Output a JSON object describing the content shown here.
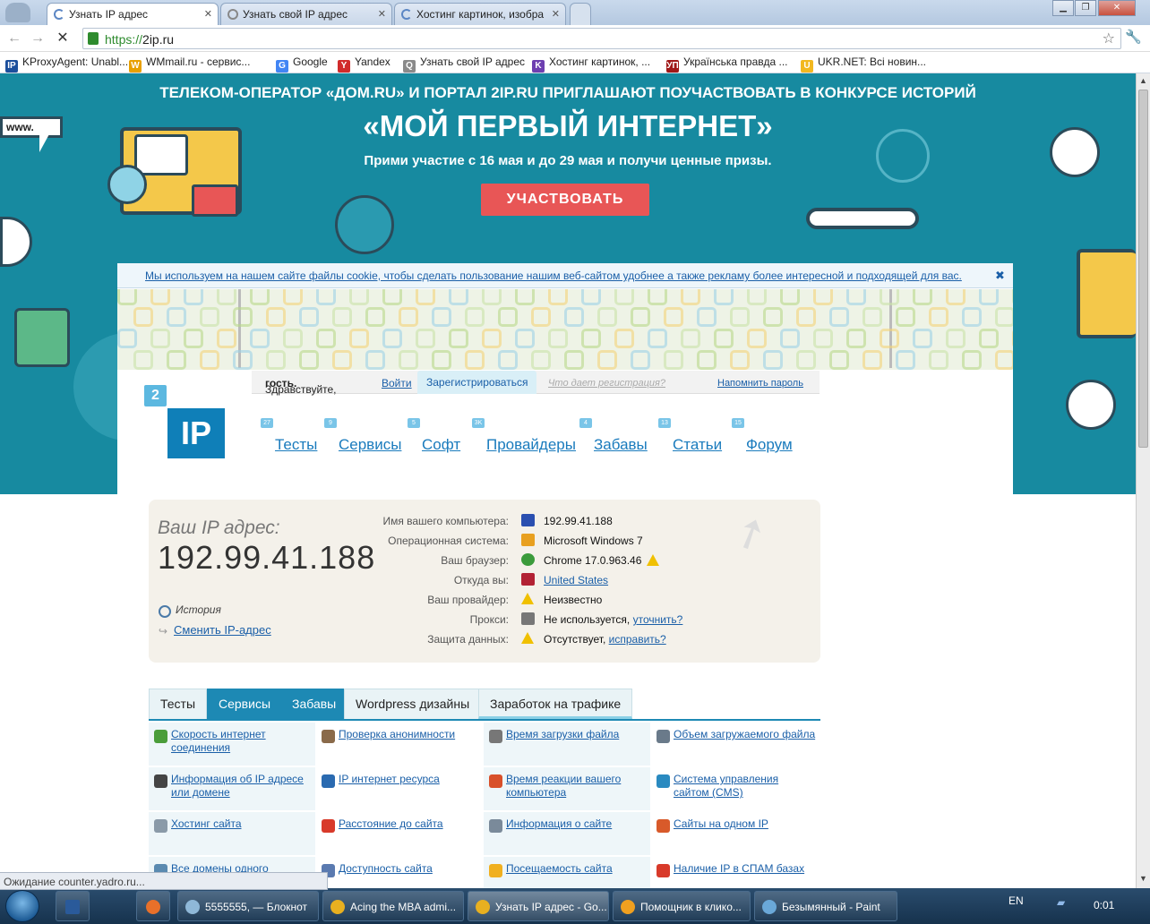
{
  "browser": {
    "tabs": [
      {
        "label": "Узнать IP адрес",
        "active": true
      },
      {
        "label": "Узнать свой IP адрес",
        "active": false
      },
      {
        "label": "Хостинг картинок, изобра",
        "active": false
      }
    ],
    "url_protocol": "https://",
    "url_host": "2ip.ru",
    "bookmarks": [
      {
        "label": "KProxyAgent: Unabl...",
        "icon": "kproxy-icon",
        "color": "#1c4f9c",
        "glyph": "IP"
      },
      {
        "label": "WMmail.ru - сервис...",
        "icon": "wmmail-icon",
        "color": "#e8a000",
        "glyph": "W"
      },
      {
        "label": "Google",
        "icon": "google-icon",
        "color": "#4285f4",
        "glyph": "G"
      },
      {
        "label": "Yandex",
        "icon": "yandex-icon",
        "color": "#d12b2b",
        "glyph": "Y"
      },
      {
        "label": "Узнать свой IP адрес",
        "icon": "search-icon",
        "color": "#8a8a8a",
        "glyph": "Q"
      },
      {
        "label": "Хостинг картинок, ...",
        "icon": "hosting-icon",
        "color": "#6d3fb0",
        "glyph": "K"
      },
      {
        "label": "Українська правда ...",
        "icon": "pravda-icon",
        "color": "#a01818",
        "glyph": "УП"
      },
      {
        "label": "UKR.NET: Всі новин...",
        "icon": "ukrnet-icon",
        "color": "#f2b820",
        "glyph": "U"
      }
    ],
    "status": "Ожидание counter.yadro.ru..."
  },
  "banner": {
    "line1": "ТЕЛЕКОМ-ОПЕРАТОР «ДОМ.RU» И ПОРТАЛ 2IP.RU ПРИГЛАШАЮТ ПОУЧАСТВОВАТЬ В КОНКУРСЕ ИСТОРИЙ",
    "title": "«МОЙ ПЕРВЫЙ ИНТЕРНЕТ»",
    "subtitle": "Прими участие с 16 мая и до 29 мая и получи ценные призы.",
    "cta": "УЧАСТВОВАТЬ",
    "www": "www."
  },
  "cookie": {
    "text": "Мы используем на нашем сайте файлы cookie, чтобы сделать пользование нашим веб-сайтом удобнее а также рекламу более интересной и подходящей для вас.",
    "close": "✖"
  },
  "userbar": {
    "greeting": "Здравствуйте, ",
    "guest": "гость.",
    "login": "Войти",
    "register": "Зарегистрироваться",
    "why": "Что дает регистрация?",
    "remind": "Напомнить пароль"
  },
  "logo": {
    "badge": "2",
    "text": "IP"
  },
  "nav": [
    {
      "label": "Тесты",
      "badge": "27"
    },
    {
      "label": "Сервисы",
      "badge": "9"
    },
    {
      "label": "Софт",
      "badge": "5"
    },
    {
      "label": "Провайдеры",
      "badge": "3K"
    },
    {
      "label": "Забавы",
      "badge": "4"
    },
    {
      "label": "Статьи",
      "badge": "13"
    },
    {
      "label": "Форум",
      "badge": "15"
    }
  ],
  "ipinfo": {
    "your_ip_label": "Ваш IP адрес:",
    "ip": "192.99.41.188",
    "history": "История",
    "change_ip": "Сменить IP-адрес",
    "rows": [
      {
        "label": "Имя вашего компьютера:",
        "value": "192.99.41.188",
        "link": "",
        "warn": false,
        "icon": "computer-icon",
        "color": "#2a4fb0"
      },
      {
        "label": "Операционная система:",
        "value": "Microsoft Windows 7",
        "link": "",
        "warn": false,
        "icon": "windows-icon",
        "color": "#e8a020"
      },
      {
        "label": "Ваш браузер:",
        "value": "Chrome 17.0.963.46",
        "link": "",
        "warn": true,
        "icon": "chrome-icon",
        "color": "#3b9b3b"
      },
      {
        "label": "Откуда вы:",
        "value": "",
        "link": "United States",
        "warn": false,
        "icon": "us-flag-icon",
        "color": "#b22234"
      },
      {
        "label": "Ваш провайдер:",
        "value": "Неизвестно",
        "link": "",
        "warn": false,
        "icon": "warning-icon",
        "color": "#f0c000"
      },
      {
        "label": "Прокси:",
        "value": "Не используется, ",
        "link": "уточнить?",
        "warn": false,
        "icon": "glasses-icon",
        "color": "#777777"
      },
      {
        "label": "Защита данных:",
        "value": "Отсутствует, ",
        "link": "исправить?",
        "warn": false,
        "icon": "warning-icon",
        "color": "#f0c000"
      }
    ]
  },
  "page_tabs": [
    {
      "label": "Тесты",
      "style": "plain"
    },
    {
      "label": "Сервисы",
      "style": "blue"
    },
    {
      "label": "Забавы",
      "style": "blue"
    },
    {
      "label": "Wordpress дизайны",
      "style": "plain"
    },
    {
      "label": "Заработок на трафике",
      "style": "green"
    }
  ],
  "services": [
    {
      "label": "Скорость интернет соединения",
      "icon": "speed-icon",
      "color": "#4a9d3a"
    },
    {
      "label": "Проверка анонимности",
      "icon": "anonymity-icon",
      "color": "#8a6a4a"
    },
    {
      "label": "Время загрузки файла",
      "icon": "clock-icon",
      "color": "#777777"
    },
    {
      "label": "Объем загружаемого файла",
      "icon": "file-size-icon",
      "color": "#6a7a8a"
    },
    {
      "label": "Информация об IP адресе или домене",
      "icon": "ip-info-icon",
      "color": "#444444"
    },
    {
      "label": "IP интернет ресурса",
      "icon": "ip-resource-icon",
      "color": "#2a6ab0"
    },
    {
      "label": "Время реакции вашего компьютера",
      "icon": "reaction-icon",
      "color": "#d8502a"
    },
    {
      "label": "Система управления сайтом (CMS)",
      "icon": "cms-icon",
      "color": "#2a8ac0"
    },
    {
      "label": "Хостинг сайта",
      "icon": "hosting-site-icon",
      "color": "#8a9aa8"
    },
    {
      "label": "Расстояние до сайта",
      "icon": "pin-icon",
      "color": "#d83a2a"
    },
    {
      "label": "Информация о сайте",
      "icon": "site-info-icon",
      "color": "#7a8a9a"
    },
    {
      "label": "Сайты на одном IP",
      "icon": "sites-same-ip-icon",
      "color": "#d85a2a"
    },
    {
      "label": "Все домены одного",
      "icon": "domains-icon",
      "color": "#5a8ab0"
    },
    {
      "label": "Доступность сайта",
      "icon": "availability-icon",
      "color": "#5a7ab0"
    },
    {
      "label": "Посещаемость сайта",
      "icon": "star-icon",
      "color": "#f0b020"
    },
    {
      "label": "Наличие IP в СПАМ базах",
      "icon": "spam-icon",
      "color": "#d83a2a"
    }
  ],
  "taskbar": {
    "items": [
      {
        "label": "5555555, — Блокнот",
        "icon": "notepad-icon",
        "color": "#8fb8d8"
      },
      {
        "label": "Acing the MBA admi...",
        "icon": "chrome-task-icon",
        "color": "#e8b020"
      },
      {
        "label": "Узнать IP адрес - Go...",
        "icon": "chrome-task-icon",
        "color": "#e8b020"
      },
      {
        "label": "Помощник в клико...",
        "icon": "helper-icon",
        "color": "#f0a020"
      },
      {
        "label": "Безымянный - Paint",
        "icon": "paint-icon",
        "color": "#6aa8d8"
      }
    ],
    "lang": "EN",
    "time": "0:01"
  }
}
